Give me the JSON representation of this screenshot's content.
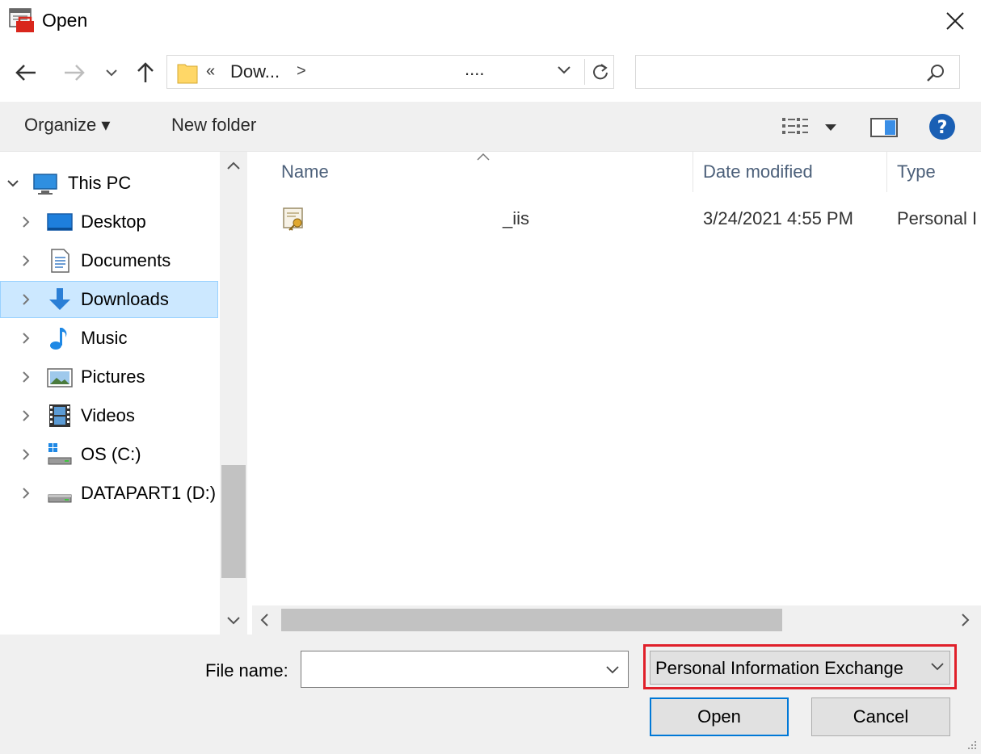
{
  "window": {
    "title": "Open"
  },
  "address": {
    "crumb_prefix": "«",
    "crumb": "Dow...",
    "crumb_chevron": ">",
    "tail": "...."
  },
  "search": {
    "placeholder": ""
  },
  "toolbar": {
    "organize": "Organize ▾",
    "new_folder": "New folder"
  },
  "nav_tree": [
    {
      "label": "This PC",
      "expanded": true
    },
    {
      "label": "Desktop"
    },
    {
      "label": "Documents"
    },
    {
      "label": "Downloads",
      "selected": true
    },
    {
      "label": "Music"
    },
    {
      "label": "Pictures"
    },
    {
      "label": "Videos"
    },
    {
      "label": "OS (C:)"
    },
    {
      "label": "DATAPART1 (D:)"
    }
  ],
  "columns": {
    "name": "Name",
    "date": "Date modified",
    "type": "Type"
  },
  "files": [
    {
      "name": "_iis",
      "date": "3/24/2021 4:55 PM",
      "type": "Personal I"
    }
  ],
  "footer": {
    "file_name_label": "File name:",
    "file_name_value": "",
    "file_type": "Personal Information Exchange",
    "open_button": "Open",
    "cancel_button": "Cancel"
  },
  "colors": {
    "selection": "#cce8ff",
    "highlight_outline": "#e0202a",
    "help_icon": "#1a5fb4",
    "default_button_border": "#0078d7"
  }
}
